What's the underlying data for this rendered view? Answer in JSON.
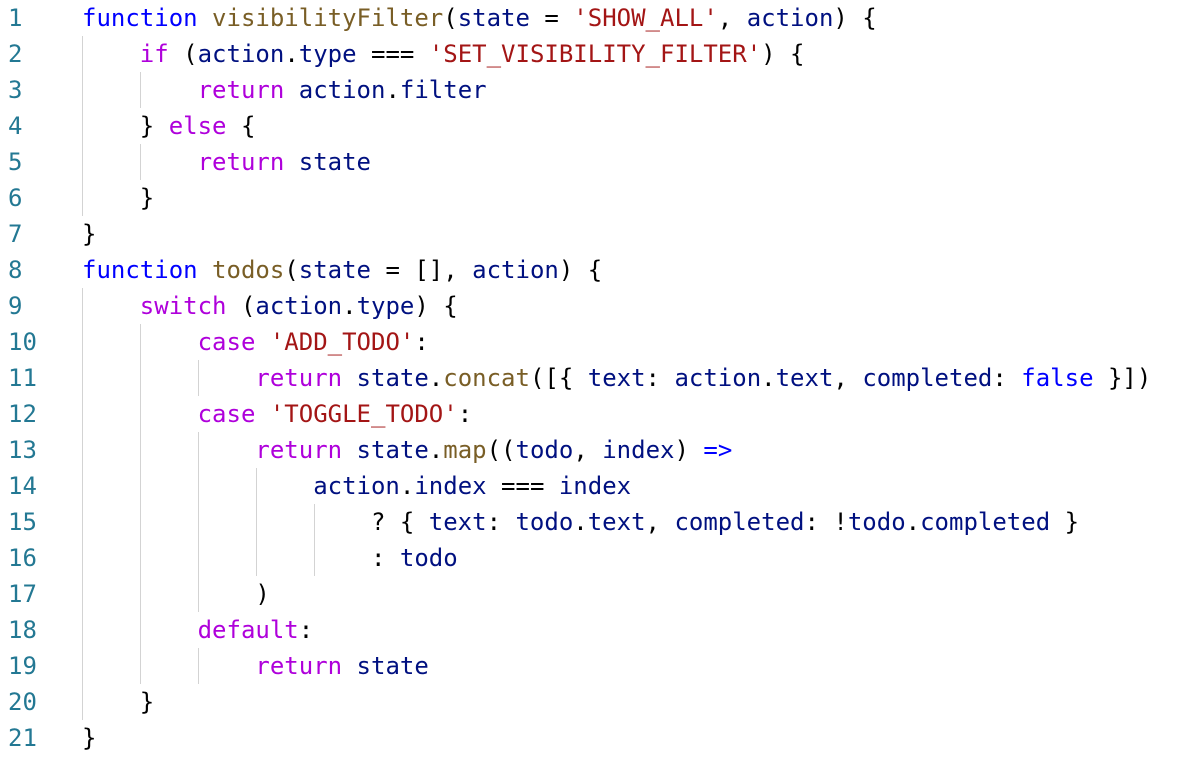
{
  "editor": {
    "line_numbers": [
      "1",
      "2",
      "3",
      "4",
      "5",
      "6",
      "7",
      "8",
      "9",
      "10",
      "11",
      "12",
      "13",
      "14",
      "15",
      "16",
      "17",
      "18",
      "19",
      "20",
      "21"
    ],
    "lines": [
      [
        {
          "t": "function",
          "c": "kw"
        },
        {
          "t": " ",
          "c": "pun"
        },
        {
          "t": "visibilityFilter",
          "c": "fn"
        },
        {
          "t": "(",
          "c": "pun"
        },
        {
          "t": "state",
          "c": "var"
        },
        {
          "t": " = ",
          "c": "pun"
        },
        {
          "t": "'SHOW_ALL'",
          "c": "str"
        },
        {
          "t": ", ",
          "c": "pun"
        },
        {
          "t": "action",
          "c": "var"
        },
        {
          "t": ") {",
          "c": "pun"
        }
      ],
      [
        {
          "t": "    ",
          "c": "pun"
        },
        {
          "t": "if",
          "c": "ctl"
        },
        {
          "t": " (",
          "c": "pun"
        },
        {
          "t": "action",
          "c": "var"
        },
        {
          "t": ".",
          "c": "pun"
        },
        {
          "t": "type",
          "c": "var"
        },
        {
          "t": " === ",
          "c": "pun"
        },
        {
          "t": "'SET_VISIBILITY_FILTER'",
          "c": "str"
        },
        {
          "t": ") {",
          "c": "pun"
        }
      ],
      [
        {
          "t": "        ",
          "c": "pun"
        },
        {
          "t": "return",
          "c": "ctl"
        },
        {
          "t": " ",
          "c": "pun"
        },
        {
          "t": "action",
          "c": "var"
        },
        {
          "t": ".",
          "c": "pun"
        },
        {
          "t": "filter",
          "c": "var"
        }
      ],
      [
        {
          "t": "    } ",
          "c": "pun"
        },
        {
          "t": "else",
          "c": "ctl"
        },
        {
          "t": " {",
          "c": "pun"
        }
      ],
      [
        {
          "t": "        ",
          "c": "pun"
        },
        {
          "t": "return",
          "c": "ctl"
        },
        {
          "t": " ",
          "c": "pun"
        },
        {
          "t": "state",
          "c": "var"
        }
      ],
      [
        {
          "t": "    }",
          "c": "pun"
        }
      ],
      [
        {
          "t": "}",
          "c": "pun"
        }
      ],
      [
        {
          "t": "function",
          "c": "kw"
        },
        {
          "t": " ",
          "c": "pun"
        },
        {
          "t": "todos",
          "c": "fn"
        },
        {
          "t": "(",
          "c": "pun"
        },
        {
          "t": "state",
          "c": "var"
        },
        {
          "t": " = [], ",
          "c": "pun"
        },
        {
          "t": "action",
          "c": "var"
        },
        {
          "t": ") {",
          "c": "pun"
        }
      ],
      [
        {
          "t": "    ",
          "c": "pun"
        },
        {
          "t": "switch",
          "c": "ctl"
        },
        {
          "t": " (",
          "c": "pun"
        },
        {
          "t": "action",
          "c": "var"
        },
        {
          "t": ".",
          "c": "pun"
        },
        {
          "t": "type",
          "c": "var"
        },
        {
          "t": ") {",
          "c": "pun"
        }
      ],
      [
        {
          "t": "        ",
          "c": "pun"
        },
        {
          "t": "case",
          "c": "ctl"
        },
        {
          "t": " ",
          "c": "pun"
        },
        {
          "t": "'ADD_TODO'",
          "c": "str"
        },
        {
          "t": ":",
          "c": "pun"
        }
      ],
      [
        {
          "t": "            ",
          "c": "pun"
        },
        {
          "t": "return",
          "c": "ctl"
        },
        {
          "t": " ",
          "c": "pun"
        },
        {
          "t": "state",
          "c": "var"
        },
        {
          "t": ".",
          "c": "pun"
        },
        {
          "t": "concat",
          "c": "fn"
        },
        {
          "t": "([{ ",
          "c": "pun"
        },
        {
          "t": "text",
          "c": "var"
        },
        {
          "t": ": ",
          "c": "pun"
        },
        {
          "t": "action",
          "c": "var"
        },
        {
          "t": ".",
          "c": "pun"
        },
        {
          "t": "text",
          "c": "var"
        },
        {
          "t": ", ",
          "c": "pun"
        },
        {
          "t": "completed",
          "c": "var"
        },
        {
          "t": ": ",
          "c": "pun"
        },
        {
          "t": "false",
          "c": "kw"
        },
        {
          "t": " }])",
          "c": "pun"
        }
      ],
      [
        {
          "t": "        ",
          "c": "pun"
        },
        {
          "t": "case",
          "c": "ctl"
        },
        {
          "t": " ",
          "c": "pun"
        },
        {
          "t": "'TOGGLE_TODO'",
          "c": "str"
        },
        {
          "t": ":",
          "c": "pun"
        }
      ],
      [
        {
          "t": "            ",
          "c": "pun"
        },
        {
          "t": "return",
          "c": "ctl"
        },
        {
          "t": " ",
          "c": "pun"
        },
        {
          "t": "state",
          "c": "var"
        },
        {
          "t": ".",
          "c": "pun"
        },
        {
          "t": "map",
          "c": "fn"
        },
        {
          "t": "((",
          "c": "pun"
        },
        {
          "t": "todo",
          "c": "var"
        },
        {
          "t": ", ",
          "c": "pun"
        },
        {
          "t": "index",
          "c": "var"
        },
        {
          "t": ") ",
          "c": "pun"
        },
        {
          "t": "=>",
          "c": "arrow"
        }
      ],
      [
        {
          "t": "                ",
          "c": "pun"
        },
        {
          "t": "action",
          "c": "var"
        },
        {
          "t": ".",
          "c": "pun"
        },
        {
          "t": "index",
          "c": "var"
        },
        {
          "t": " === ",
          "c": "pun"
        },
        {
          "t": "index",
          "c": "var"
        }
      ],
      [
        {
          "t": "                    ? { ",
          "c": "pun"
        },
        {
          "t": "text",
          "c": "var"
        },
        {
          "t": ": ",
          "c": "pun"
        },
        {
          "t": "todo",
          "c": "var"
        },
        {
          "t": ".",
          "c": "pun"
        },
        {
          "t": "text",
          "c": "var"
        },
        {
          "t": ", ",
          "c": "pun"
        },
        {
          "t": "completed",
          "c": "var"
        },
        {
          "t": ": !",
          "c": "pun"
        },
        {
          "t": "todo",
          "c": "var"
        },
        {
          "t": ".",
          "c": "pun"
        },
        {
          "t": "completed",
          "c": "var"
        },
        {
          "t": " }",
          "c": "pun"
        }
      ],
      [
        {
          "t": "                    : ",
          "c": "pun"
        },
        {
          "t": "todo",
          "c": "var"
        }
      ],
      [
        {
          "t": "            )",
          "c": "pun"
        }
      ],
      [
        {
          "t": "        ",
          "c": "pun"
        },
        {
          "t": "default",
          "c": "ctl"
        },
        {
          "t": ":",
          "c": "pun"
        }
      ],
      [
        {
          "t": "            ",
          "c": "pun"
        },
        {
          "t": "return",
          "c": "ctl"
        },
        {
          "t": " ",
          "c": "pun"
        },
        {
          "t": "state",
          "c": "var"
        }
      ],
      [
        {
          "t": "    }",
          "c": "pun"
        }
      ],
      [
        {
          "t": "}",
          "c": "pun"
        }
      ]
    ]
  }
}
